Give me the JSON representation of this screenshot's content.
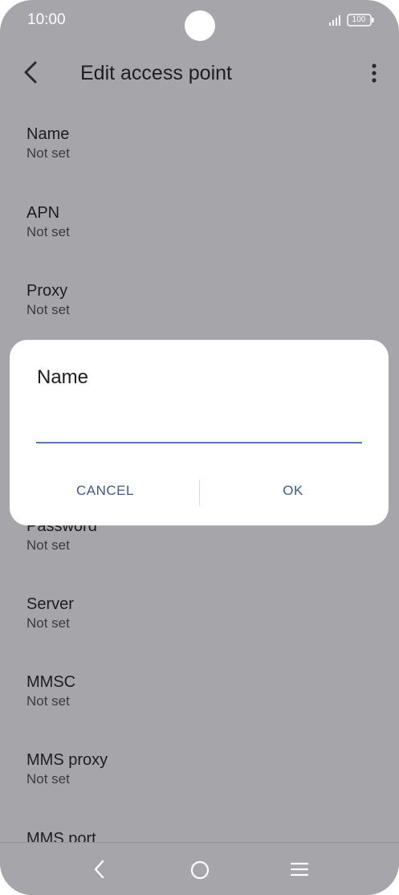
{
  "status_bar": {
    "time": "10:00",
    "battery": "100"
  },
  "header": {
    "title": "Edit access point"
  },
  "settings": [
    {
      "label": "Name",
      "value": "Not set"
    },
    {
      "label": "APN",
      "value": "Not set"
    },
    {
      "label": "Proxy",
      "value": "Not set"
    },
    {
      "label": "Password",
      "value": "Not set"
    },
    {
      "label": "Server",
      "value": "Not set"
    },
    {
      "label": "MMSC",
      "value": "Not set"
    },
    {
      "label": "MMS proxy",
      "value": "Not set"
    },
    {
      "label": "MMS port",
      "value": ""
    }
  ],
  "dialog": {
    "title": "Name",
    "input_value": "",
    "cancel_label": "CANCEL",
    "ok_label": "OK"
  },
  "colors": {
    "overlay_background": "#a6a5aa",
    "accent": "#5577b6",
    "button_text": "#3e5a8f"
  }
}
